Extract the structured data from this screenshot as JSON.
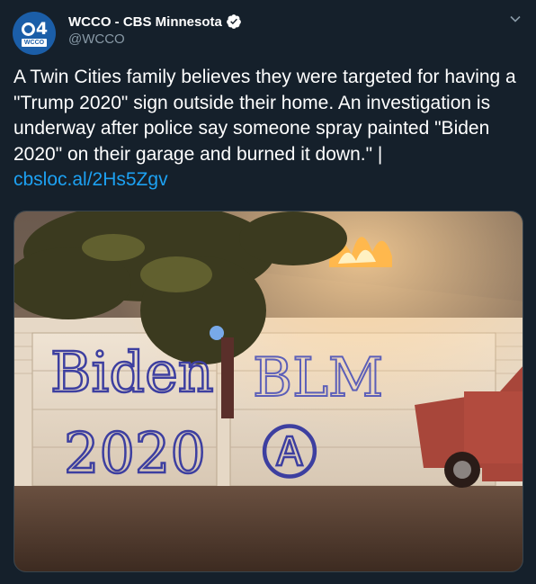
{
  "account": {
    "display_name": "WCCO - CBS Minnesota",
    "handle": "@WCCO",
    "avatar_number": "4",
    "avatar_text": "WCCO",
    "verified": true
  },
  "tweet": {
    "text": "A Twin Cities family believes they were targeted for having a \"Trump 2020\" sign outside their home. An investigation is underway after police say someone spray painted \"Biden 2020\" on their garage and burned it down.\" | ",
    "link": "cbsloc.al/2Hs5Zgv"
  },
  "media": {
    "graffiti_left_top": "Biden",
    "graffiti_left_bottom": "2020",
    "graffiti_right_top": "BLM",
    "graffiti_right_bottom": "Ⓐ"
  },
  "icons": {
    "verified": "verified-badge-icon",
    "menu": "chevron-down-icon"
  },
  "colors": {
    "background": "#15202b",
    "link": "#1da1f2",
    "secondary_text": "#8899a6",
    "avatar_blue": "#1b5ea8"
  }
}
